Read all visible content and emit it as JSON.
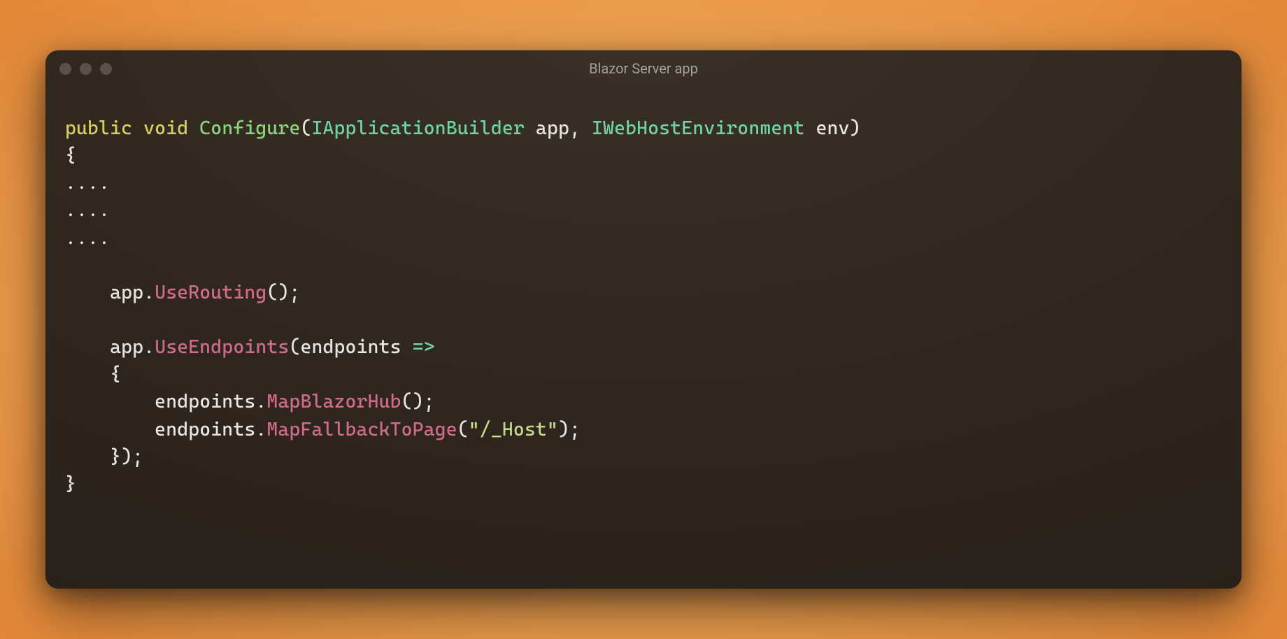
{
  "window": {
    "title": "Blazor Server app"
  },
  "code": {
    "tokens": {
      "kw_public": "public",
      "kw_void": "void",
      "fn_configure": "Configure",
      "typ_iab": "IApplicationBuilder",
      "typ_iwhe": "IWebHostEnvironment",
      "id_app": "app",
      "id_env": "env",
      "brace_open": "{",
      "brace_close": "}",
      "dots1": "....",
      "dots2": "....",
      "dots3": "....",
      "mth_userouting": "UseRouting",
      "mth_useendpoints": "UseEndpoints",
      "id_endpoints": "endpoints",
      "arrow": "=>",
      "mth_mapblazorhub": "MapBlazorHub",
      "mth_mapfallback": "MapFallbackToPage",
      "str_host": "\"/_Host\""
    }
  },
  "colors": {
    "keyword": "#d7cf5a",
    "function": "#8bd47c",
    "type": "#6fd4a0",
    "method": "#d16b8a",
    "string": "#c4d88a",
    "plain": "#e9e6df",
    "bg_gradient_inner": "#f9c27a",
    "bg_gradient_outer": "#dd7d34",
    "window_bg": "#2b231c",
    "title_text": "#a6a097",
    "traffic_dot": "#5a5149"
  }
}
